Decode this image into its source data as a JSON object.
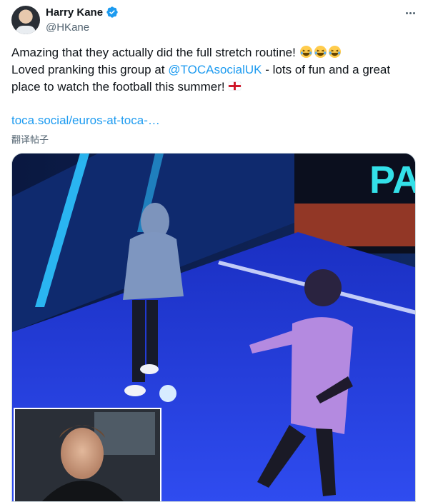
{
  "author": {
    "display_name": "Harry Kane",
    "handle": "@HKane",
    "verified": true,
    "avatar_icon": "profile-photo"
  },
  "menu": {
    "icon": "more-horizontal-icon"
  },
  "tweet": {
    "line1_text": "Amazing that they actually did the full stretch routine! ",
    "line1_emojis": [
      "face-with-tears-of-joy",
      "face-with-tears-of-joy",
      "face-with-tears-of-joy"
    ],
    "line2_before": "Loved pranking this group at ",
    "line2_mention": "@TOCAsocialUK",
    "line2_after": " - lots of fun and a great",
    "line3_text": "place to watch the football this summer! ",
    "line3_emoji": "flag-england",
    "link": "toca.social/euros-at-toca-…",
    "translate": "翻译帖子"
  },
  "media": {
    "type": "video",
    "scene": "football-pitch",
    "wall_sign_text": "PA",
    "inset": "face-cam"
  },
  "colors": {
    "text": "#0f1419",
    "secondary": "#536471",
    "link": "#1d9bf0",
    "border": "#cfd9de",
    "pitch": "#1e3bd6"
  }
}
